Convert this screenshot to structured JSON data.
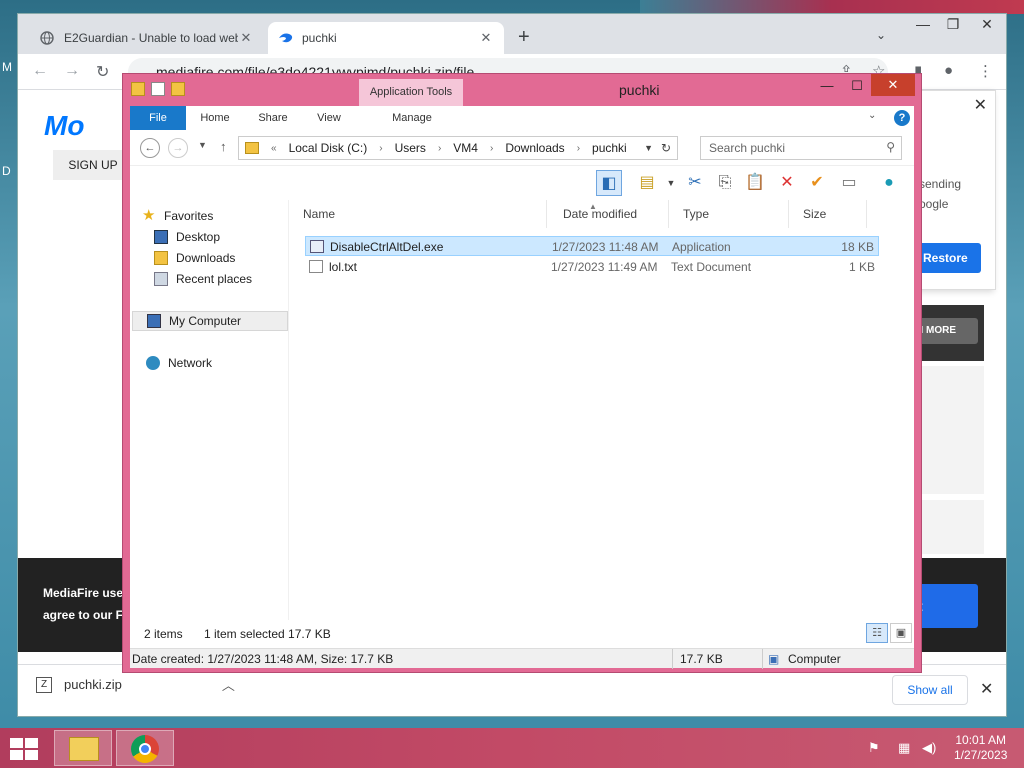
{
  "browser": {
    "tabs": [
      {
        "title": "E2Guardian - Unable to load web",
        "close": "✕"
      },
      {
        "title": "puchki",
        "close": "✕"
      }
    ],
    "new_tab": "+",
    "tab_menu": "⌄",
    "address": "mediafire.com/file/e3do4221ywvpimd/puchki.zip/file"
  },
  "page": {
    "logo": "Mo",
    "signup": "SIGN UP",
    "popup": {
      "text1": "sending",
      "text2": "oogle",
      "restore": "Restore"
    },
    "learn_more": "N MORE",
    "cookie": {
      "line1": "MediaFire use",
      "line2": "agree to our F",
      "button": "t"
    }
  },
  "downloads": {
    "file": "puchki.zip",
    "show_all": "Show all"
  },
  "explorer": {
    "title": "puchki",
    "contextual_header": "Application Tools",
    "ribbon_tabs": [
      "File",
      "Home",
      "Share",
      "View",
      "Manage"
    ],
    "path": [
      "Local Disk (C:)",
      "Users",
      "VM4",
      "Downloads",
      "puchki"
    ],
    "path_prefix": "«",
    "search_placeholder": "Search puchki",
    "nav": {
      "favorites": "Favorites",
      "desktop": "Desktop",
      "downloads": "Downloads",
      "recent": "Recent places",
      "my_computer": "My Computer",
      "network": "Network"
    },
    "columns": [
      "Name",
      "Date modified",
      "Type",
      "Size"
    ],
    "files": [
      {
        "name": "DisableCtrlAltDel.exe",
        "date": "1/27/2023 11:48 AM",
        "type": "Application",
        "size": "18 KB"
      },
      {
        "name": "lol.txt",
        "date": "1/27/2023 11:49 AM",
        "type": "Text Document",
        "size": "1 KB"
      }
    ],
    "status": {
      "items": "2 items",
      "selected": "1 item selected  17.7 KB",
      "details": "Date created: 1/27/2023 11:48 AM, Size: 17.7 KB",
      "size": "17.7 KB",
      "location": "Computer"
    }
  },
  "taskbar": {
    "time": "10:01 AM",
    "date": "1/27/2023"
  },
  "colors": {
    "explorer_frame": "#e26a94",
    "taskbar": "#c24a66",
    "accent": "#1979ca"
  }
}
